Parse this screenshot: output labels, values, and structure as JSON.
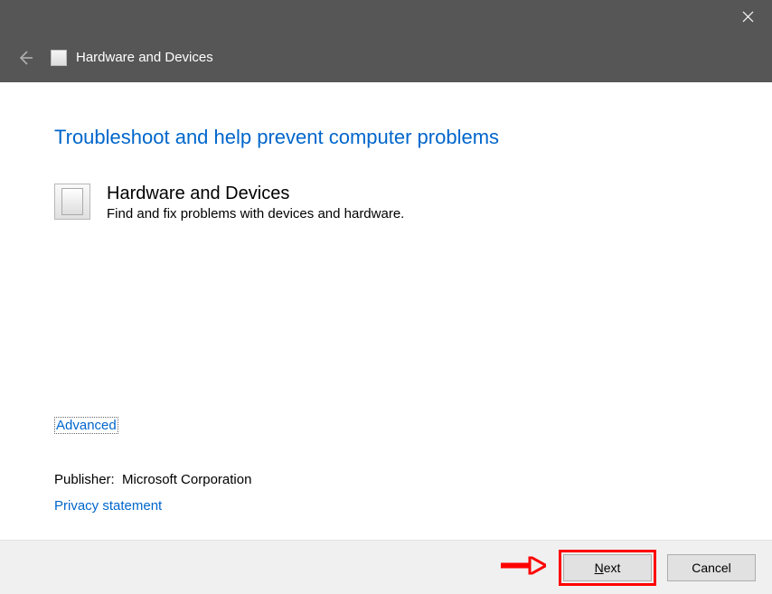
{
  "header": {
    "title": "Hardware and Devices"
  },
  "main": {
    "heading": "Troubleshoot and help prevent computer problems",
    "troubleshooter_title": "Hardware and Devices",
    "troubleshooter_desc": "Find and fix problems with devices and hardware."
  },
  "links": {
    "advanced": "Advanced",
    "publisher_label": "Publisher:",
    "publisher_value": "Microsoft Corporation",
    "privacy": "Privacy statement"
  },
  "footer": {
    "next": "Next",
    "cancel": "Cancel"
  }
}
